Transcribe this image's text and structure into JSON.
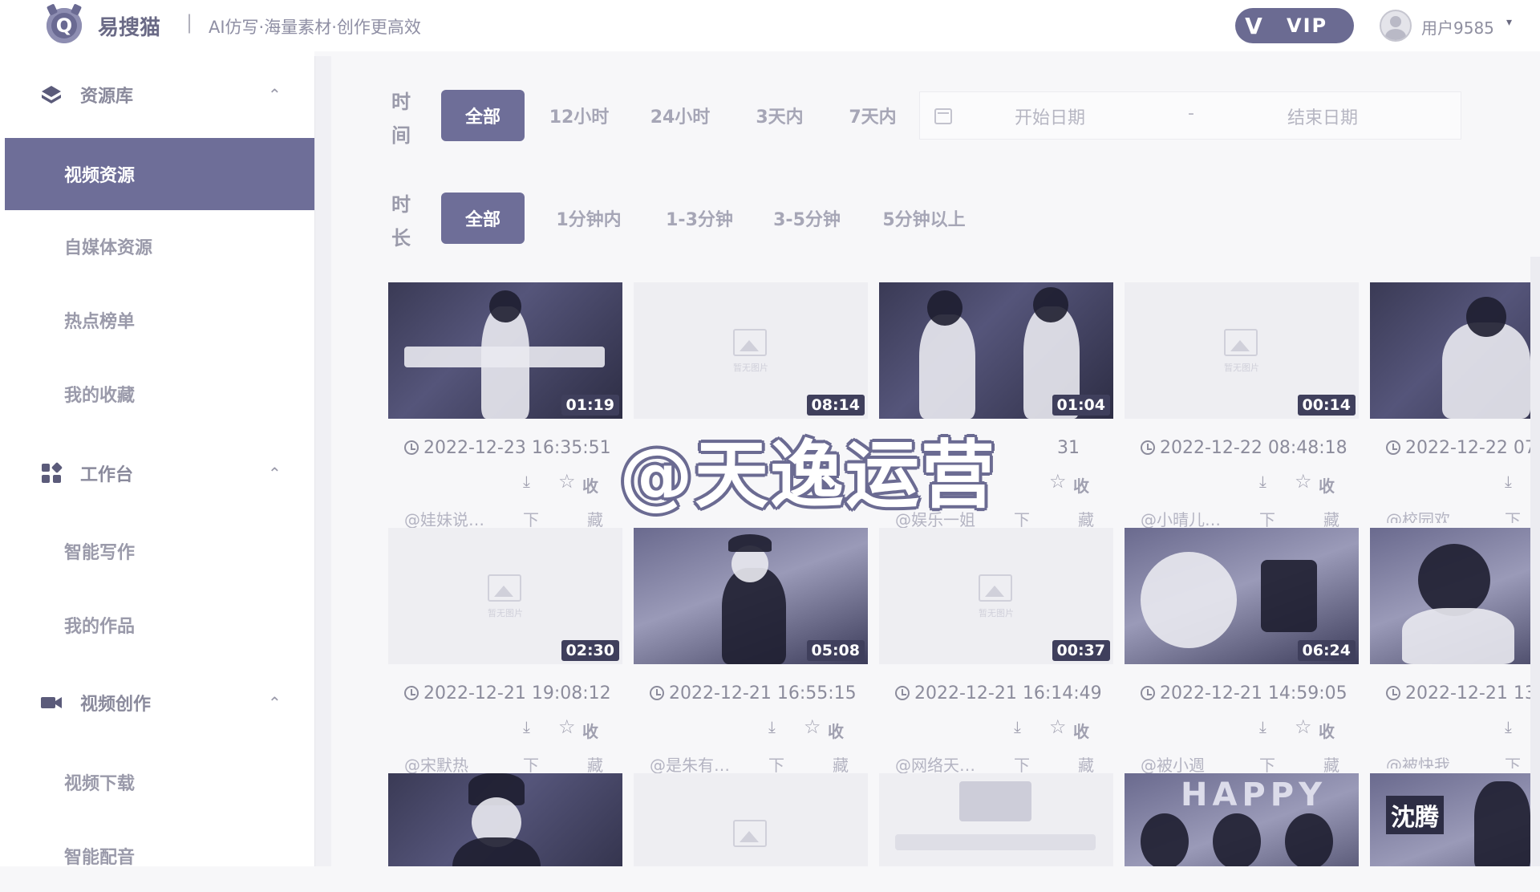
{
  "header": {
    "brand": "易搜猫",
    "separator": "|",
    "tagline": "AI仿写·海量素材·创作更高效",
    "vip_label": "VIP",
    "username": "用户9585",
    "caret": "▾"
  },
  "sidebar": {
    "groups": [
      {
        "label": "资源库",
        "icon": "layers-icon",
        "caret": "⌃"
      },
      {
        "label": "工作台",
        "icon": "grid-icon",
        "caret": "⌃"
      },
      {
        "label": "视频创作",
        "icon": "video-camera-icon",
        "caret": "⌃"
      }
    ],
    "items": [
      {
        "label": "视频资源",
        "active": true
      },
      {
        "label": "自媒体资源"
      },
      {
        "label": "热点榜单"
      },
      {
        "label": "我的收藏"
      },
      {
        "label": "智能写作"
      },
      {
        "label": "我的作品"
      },
      {
        "label": "视频下载"
      },
      {
        "label": "智能配音"
      }
    ]
  },
  "filters": {
    "time_label": [
      "时",
      "间"
    ],
    "time_options": [
      "全部",
      "12小时",
      "24小时",
      "3天内",
      "7天内"
    ],
    "date_start_placeholder": "开始日期",
    "date_separator": "-",
    "date_end_placeholder": "结束日期",
    "duration_label": [
      "时",
      "长"
    ],
    "duration_options": [
      "全部",
      "1分钟内",
      "1-3分钟",
      "3-5分钟",
      "5分钟以上"
    ]
  },
  "card_common": {
    "download_icon": "⤓",
    "star_icon": "☆",
    "fav_label": "收",
    "download_text": "下",
    "fav_text": "藏"
  },
  "videos": [
    {
      "duration": "01:19",
      "date": "2022-12-23 16:35:51",
      "author": "@娃妹说…",
      "thumb": "dark"
    },
    {
      "duration": "08:14",
      "date": "",
      "author": "",
      "thumb": "placeholder"
    },
    {
      "duration": "01:04",
      "date": "31",
      "author": "@娱乐一姐",
      "thumb": "dark"
    },
    {
      "duration": "00:14",
      "date": "2022-12-22 08:48:18",
      "author": "@小晴儿…",
      "thumb": "placeholder"
    },
    {
      "duration": "",
      "date": "2022-12-22 07",
      "author": "@校园欢",
      "thumb": "dark"
    },
    {
      "duration": "02:30",
      "date": "2022-12-21 19:08:12",
      "author": "@宋默热",
      "thumb": "placeholder"
    },
    {
      "duration": "05:08",
      "date": "2022-12-21 16:55:15",
      "author": "@是朱有…",
      "thumb": "mid"
    },
    {
      "duration": "00:37",
      "date": "2022-12-21 16:14:49",
      "author": "@网络天…",
      "thumb": "placeholder"
    },
    {
      "duration": "06:24",
      "date": "2022-12-21 14:59:05",
      "author": "@被小週",
      "thumb": "mid"
    },
    {
      "duration": "",
      "date": "2022-12-21 13:",
      "author": "@被快我",
      "thumb": "mid"
    },
    {
      "duration": "",
      "date": "",
      "author": "",
      "thumb": "dark"
    },
    {
      "duration": "",
      "date": "",
      "author": "",
      "thumb": "placeholder"
    },
    {
      "duration": "",
      "date": "",
      "author": "",
      "thumb": "placeholder"
    },
    {
      "duration": "",
      "date": "",
      "author": "",
      "thumb": "mid"
    },
    {
      "duration": "",
      "date": "",
      "author": "",
      "thumb": "mid"
    }
  ],
  "thumb_text": {
    "placeholder_caption": "暂无图片",
    "thumb_15_caption": "沈腾",
    "thumb_14_caption": "HAPPY"
  },
  "watermark": "@天逸运营",
  "colors": {
    "accent": "#6e6e98",
    "text": "#8a8a9c"
  }
}
